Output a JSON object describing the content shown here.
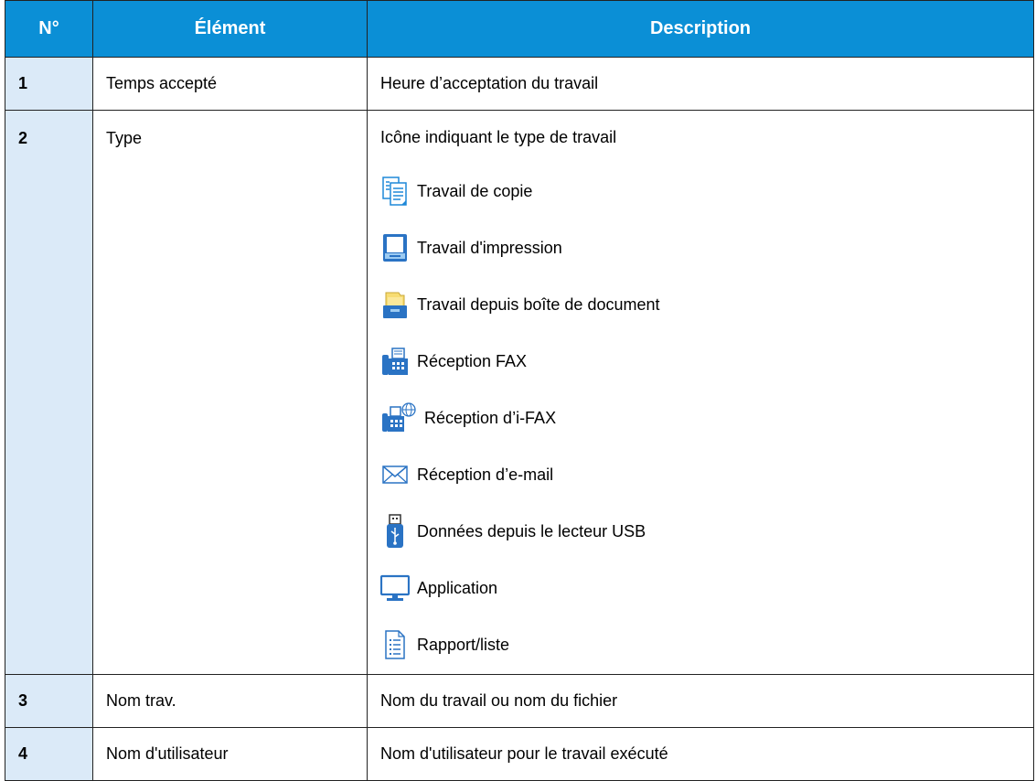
{
  "headers": {
    "num": "N°",
    "element": "Élément",
    "description": "Description"
  },
  "rows": [
    {
      "num": "1",
      "element": "Temps accepté",
      "description": "Heure d’acceptation du travail"
    },
    {
      "num": "2",
      "element": "Type",
      "description": "Icône indiquant le type de travail",
      "types": [
        {
          "icon": "copy-icon",
          "label": "Travail de copie"
        },
        {
          "icon": "printer-icon",
          "label": "Travail d'impression"
        },
        {
          "icon": "document-box-icon",
          "label": "Travail depuis boîte de document"
        },
        {
          "icon": "fax-icon",
          "label": "Réception FAX"
        },
        {
          "icon": "ifax-icon",
          "label": "Réception d’i-FAX"
        },
        {
          "icon": "email-icon",
          "label": "Réception d’e-mail"
        },
        {
          "icon": "usb-icon",
          "label": "Données depuis le lecteur USB"
        },
        {
          "icon": "monitor-icon",
          "label": "Application"
        },
        {
          "icon": "report-icon",
          "label": "Rapport/liste"
        }
      ]
    },
    {
      "num": "3",
      "element": "Nom trav.",
      "description": "Nom du travail ou nom du fichier"
    },
    {
      "num": "4",
      "element": "Nom d'utilisateur",
      "description": "Nom d'utilisateur pour le travail exécuté"
    }
  ],
  "colors": {
    "header_bg": "#0b8fd6",
    "num_col_bg": "#dbeaf8",
    "icon_blue": "#1e88d8"
  }
}
